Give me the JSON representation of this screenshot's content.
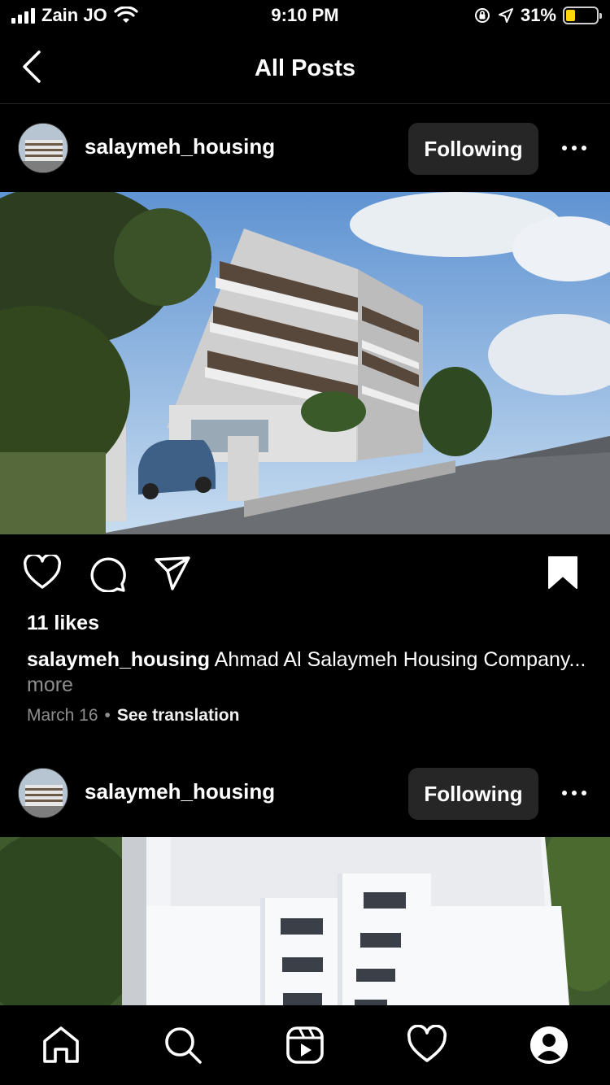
{
  "status_bar": {
    "carrier": "Zain JO",
    "time": "9:10 PM",
    "battery_percent": "31%",
    "battery_level": 0.31,
    "icons": [
      "signal-icon",
      "wifi-icon",
      "orientation-lock-icon",
      "location-icon",
      "battery-icon"
    ]
  },
  "header": {
    "title": "All Posts",
    "back_icon": "chevron-left-icon"
  },
  "posts": [
    {
      "username": "salaymeh_housing",
      "follow_label": "Following",
      "more_icon": "ellipsis-icon",
      "likes": "11 likes",
      "caption_user": "salaymeh_housing",
      "caption_text": "Ahmad Al Salaymeh Housing Company...",
      "caption_more": "more",
      "date": "March 16",
      "separator": "•",
      "translation_label": "See translation"
    },
    {
      "username": "salaymeh_housing",
      "follow_label": "Following",
      "more_icon": "ellipsis-icon"
    }
  ],
  "post_actions": [
    "heart-icon",
    "comment-icon",
    "share-icon",
    "bookmark-icon"
  ],
  "tabbar": [
    "home-icon",
    "search-icon",
    "reels-icon",
    "activity-heart-icon",
    "profile-icon"
  ],
  "colors": {
    "background": "#000000",
    "button_bg": "#262626",
    "secondary_text": "#8e8e8e",
    "battery": "#ffd60a"
  }
}
